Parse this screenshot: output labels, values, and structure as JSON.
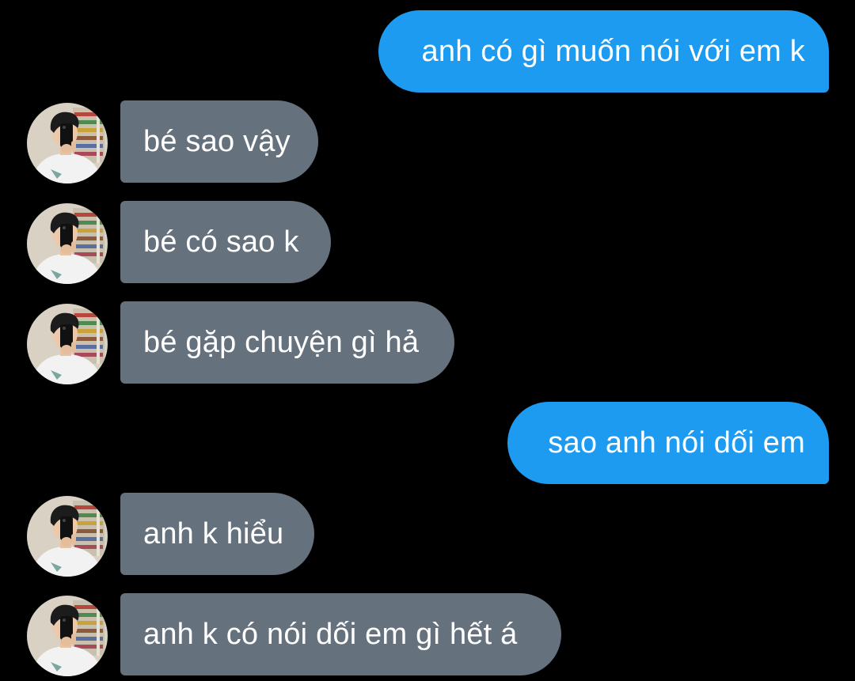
{
  "colors": {
    "background": "#000000",
    "outgoing_bubble": "#1d9bf0",
    "incoming_bubble": "#66717e",
    "text": "#ffffff"
  },
  "messages": [
    {
      "direction": "outgoing",
      "text": "anh có gì muốn nói với em k"
    },
    {
      "direction": "incoming",
      "text": "bé sao vậy",
      "avatar_icon": "contact-avatar"
    },
    {
      "direction": "incoming",
      "text": "bé có sao k",
      "avatar_icon": "contact-avatar"
    },
    {
      "direction": "incoming",
      "text": "bé gặp chuyện gì hả",
      "avatar_icon": "contact-avatar"
    },
    {
      "direction": "outgoing",
      "text": "sao anh nói dối em"
    },
    {
      "direction": "incoming",
      "text": "anh k hiểu",
      "avatar_icon": "contact-avatar"
    },
    {
      "direction": "incoming",
      "text": "anh k có nói dối em gì hết á",
      "avatar_icon": "contact-avatar"
    }
  ]
}
